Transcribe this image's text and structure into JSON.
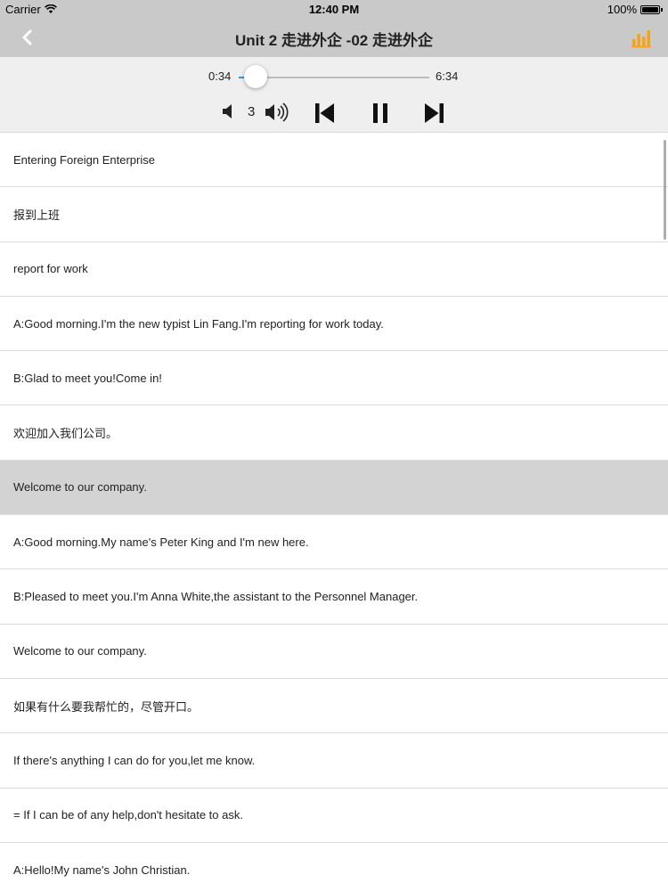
{
  "status_bar": {
    "carrier": "Carrier",
    "time": "12:40 PM",
    "battery": "100%"
  },
  "nav": {
    "title": "Unit 2 走进外企 -02 走进外企",
    "accent_color": "#f5a31a"
  },
  "player": {
    "elapsed": "0:34",
    "total": "6:34",
    "progress_fraction": 0.09,
    "volume_level": "3",
    "track_color": "#2b9bf0"
  },
  "lines": [
    {
      "text": "Entering Foreign Enterprise",
      "active": false
    },
    {
      "text": "报到上班",
      "active": false
    },
    {
      "text": "report for work",
      "active": false
    },
    {
      "text": "A:Good morning.I'm the new typist Lin Fang.I'm reporting for work today.",
      "active": false
    },
    {
      "text": "B:Glad to meet you!Come in!",
      "active": false
    },
    {
      "text": "欢迎加入我们公司。",
      "active": false
    },
    {
      "text": "Welcome to  our company.",
      "active": true
    },
    {
      "text": "A:Good morning.My name's Peter King and I'm new here.",
      "active": false
    },
    {
      "text": "B:Pleased to meet you.I'm Anna White,the assistant to the Personnel Manager.",
      "active": false
    },
    {
      "text": "Welcome to  our company.",
      "active": false
    },
    {
      "text": "如果有什么要我帮忙的，尽管开口。",
      "active": false
    },
    {
      "text": "If there's anything I can do for you,let me know.",
      "active": false
    },
    {
      "text": "= If I can be of any help,don't hesitate to ask.",
      "active": false
    },
    {
      "text": "A:Hello!My name's John Christian.",
      "active": false
    }
  ]
}
